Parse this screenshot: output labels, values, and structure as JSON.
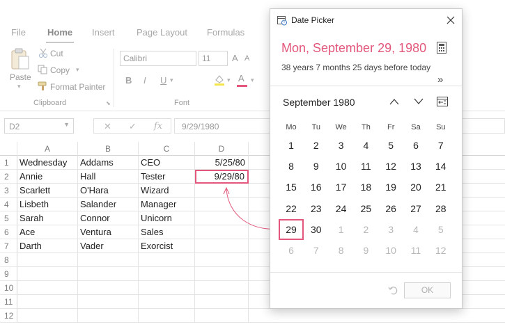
{
  "ribbon": {
    "tabs": [
      "File",
      "Home",
      "Insert",
      "Page Layout",
      "Formulas"
    ],
    "clipboard": {
      "paste": "Paste",
      "cut": "Cut",
      "copy": "Copy",
      "format_painter": "Format Painter",
      "group_label": "Clipboard"
    },
    "font": {
      "family": "Calibri",
      "size": "11",
      "grow": "A",
      "shrink": "A",
      "bold": "B",
      "italic": "I",
      "underline": "U",
      "font_color": "A",
      "group_label": "Font"
    }
  },
  "formula_bar": {
    "name_box": "D2",
    "cancel": "✕",
    "enter": "✓",
    "fx": "fx",
    "value": "9/29/1980"
  },
  "sheet": {
    "columns": [
      "A",
      "B",
      "C",
      "D"
    ],
    "row_numbers": [
      "1",
      "2",
      "3",
      "4",
      "5",
      "6",
      "7",
      "8",
      "9",
      "10",
      "11",
      "12"
    ],
    "rows": [
      [
        "Wednesday",
        "Addams",
        "CEO",
        "5/25/80"
      ],
      [
        "Annie",
        "Hall",
        "Tester",
        "9/29/80"
      ],
      [
        "Scarlett",
        "O'Hara",
        "Wizard",
        ""
      ],
      [
        "Lisbeth",
        "Salander",
        "Manager",
        ""
      ],
      [
        "Sarah",
        "Connor",
        "Unicorn",
        ""
      ],
      [
        "Ace",
        "Ventura",
        "Sales",
        ""
      ],
      [
        "Darth",
        "Vader",
        "Exorcist",
        ""
      ]
    ],
    "selected_cell": "D2"
  },
  "date_picker": {
    "title": "Date Picker",
    "selected_date": "Mon, September 29, 1980",
    "relative": "38 years 7 months 25 days before today",
    "expand": "»",
    "month_label": "September 1980",
    "weekdays": [
      "Mo",
      "Tu",
      "We",
      "Th",
      "Fr",
      "Sa",
      "Su"
    ],
    "weeks": [
      [
        "1",
        "2",
        "3",
        "4",
        "5",
        "6",
        "7"
      ],
      [
        "8",
        "9",
        "10",
        "11",
        "12",
        "13",
        "14"
      ],
      [
        "15",
        "16",
        "17",
        "18",
        "19",
        "20",
        "21"
      ],
      [
        "22",
        "23",
        "24",
        "25",
        "26",
        "27",
        "28"
      ],
      [
        "29",
        "30",
        "1",
        "2",
        "3",
        "4",
        "5"
      ],
      [
        "6",
        "7",
        "8",
        "9",
        "10",
        "11",
        "12"
      ]
    ],
    "selected_day": "29",
    "ok_label": "OK"
  },
  "colors": {
    "accent": "#e2577b",
    "muted": "#b7b7b7"
  },
  "icons": [
    "paste-icon",
    "scissors-icon",
    "copy-icon",
    "paintbrush-icon",
    "calendar-app-icon",
    "close-icon",
    "calculator-icon",
    "chevron-up-icon",
    "chevron-down-icon",
    "go-to-today-icon",
    "undo-icon"
  ]
}
